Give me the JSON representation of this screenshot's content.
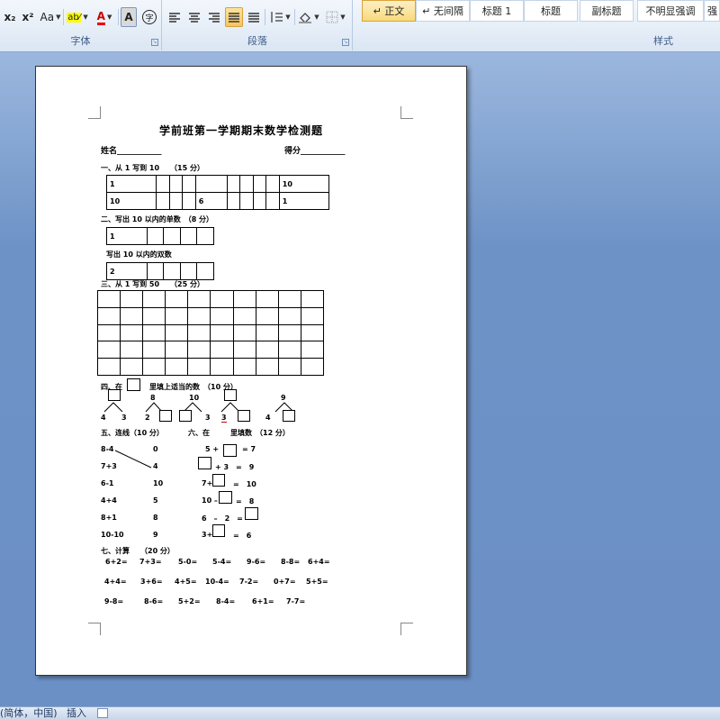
{
  "ribbon": {
    "font_group_label": "字体",
    "para_group_label": "段落",
    "styles_group_label": "样式",
    "font_buttons": {
      "subscript": "x₂",
      "superscript": "x²",
      "change_case": "Aa",
      "highlight": "ab⁄",
      "font_color": "A",
      "char_shading": "A",
      "enclose": "字"
    },
    "styles": [
      "↵ 正文",
      "↵ 无间隔",
      "标题 1",
      "标题",
      "副标题",
      "不明显强调",
      "强"
    ],
    "accent_color": "#f5c462"
  },
  "doc": {
    "title": "学前班第一学期期末数学检测题",
    "name_label": "姓名___________",
    "score_label": "得分___________",
    "s1": {
      "heading": "一、从 1 写到 10　　（15 分）",
      "row1": [
        "1",
        "",
        "",
        "",
        "",
        "",
        "",
        "",
        "",
        "10"
      ],
      "row2": [
        "10",
        "",
        "",
        "",
        "6",
        "",
        "",
        "",
        "",
        "1"
      ]
    },
    "s2": {
      "heading": "二、写出 10 以内的单数　（8 分）",
      "row": [
        "1",
        "",
        "",
        "",
        ""
      ],
      "sub": "写出 10 以内的双数",
      "row2": [
        "2",
        "",
        "",
        "",
        ""
      ]
    },
    "s3": {
      "heading": "三、从 1 写到 50　　（25 分）"
    },
    "s4": {
      "heading_a": "四、在",
      "heading_b": "里填上适当的数　（10 分）",
      "tops": [
        "8",
        "10",
        "9"
      ],
      "bottoms": [
        "4",
        "3",
        "2",
        "3",
        "3",
        "4"
      ]
    },
    "s5": {
      "heading": "五、连线（10 分）",
      "left": [
        "8-4",
        "7+3",
        "6-1",
        "4+4",
        "8+1",
        "10-10"
      ],
      "right": [
        "0",
        "4",
        "10",
        "5",
        "8",
        "9"
      ]
    },
    "s6": {
      "heading_a": "六、在",
      "heading_b": "里填数　（12 分）",
      "items": [
        "5  +",
        "= 7",
        "+ 3　=　9",
        "7+",
        "=　10",
        "10 –",
        "=　8",
        "6　–　2　=",
        "3+",
        "=　6"
      ]
    },
    "s7": {
      "heading": "七、计算　　（20 分）",
      "row1": [
        "6+2=",
        "7+3=",
        "5-0=",
        "5-4=",
        "9-6=",
        "8-8=",
        "6+4="
      ],
      "row2": [
        "4+4=",
        "3+6=",
        "4+5=",
        "10-4=",
        "7-2=",
        "0+7=",
        "5+5="
      ],
      "row3": [
        "9-8=",
        "8-6=",
        "5+2=",
        "8-4=",
        "6+1=",
        "7-7="
      ]
    }
  },
  "status": {
    "lang": "(简体，中国)",
    "mode": "插入"
  }
}
